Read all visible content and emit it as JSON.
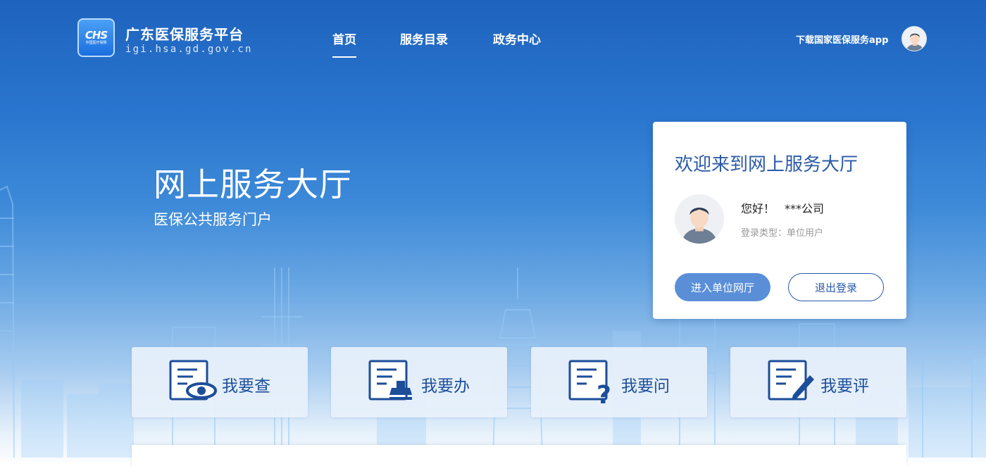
{
  "header": {
    "logo_text": "CHS",
    "logo_sub": "中国医疗保障",
    "site_title": "广东医保服务平台",
    "site_url": "igi.hsa.gd.gov.cn",
    "nav": [
      {
        "label": "首页",
        "active": true
      },
      {
        "label": "服务目录",
        "active": false
      },
      {
        "label": "政务中心",
        "active": false
      }
    ],
    "app_link": "下载国家医保服务app"
  },
  "hero": {
    "title": "网上服务大厅",
    "subtitle": "医保公共服务门户"
  },
  "login_card": {
    "title": "欢迎来到网上服务大厅",
    "greeting": "您好！",
    "company": "***公司",
    "login_type": "登录类型：单位用户",
    "enter_button": "进入单位网厅",
    "logout_button": "退出登录"
  },
  "services": [
    {
      "label": "我要查",
      "icon": "doc-eye-icon"
    },
    {
      "label": "我要办",
      "icon": "doc-stamp-icon"
    },
    {
      "label": "我要问",
      "icon": "doc-question-icon"
    },
    {
      "label": "我要评",
      "icon": "doc-pen-icon"
    }
  ],
  "colors": {
    "brand_blue": "#1e63bd",
    "accent_text": "#2b5aa8",
    "enter_button": "#5a8fd8"
  }
}
